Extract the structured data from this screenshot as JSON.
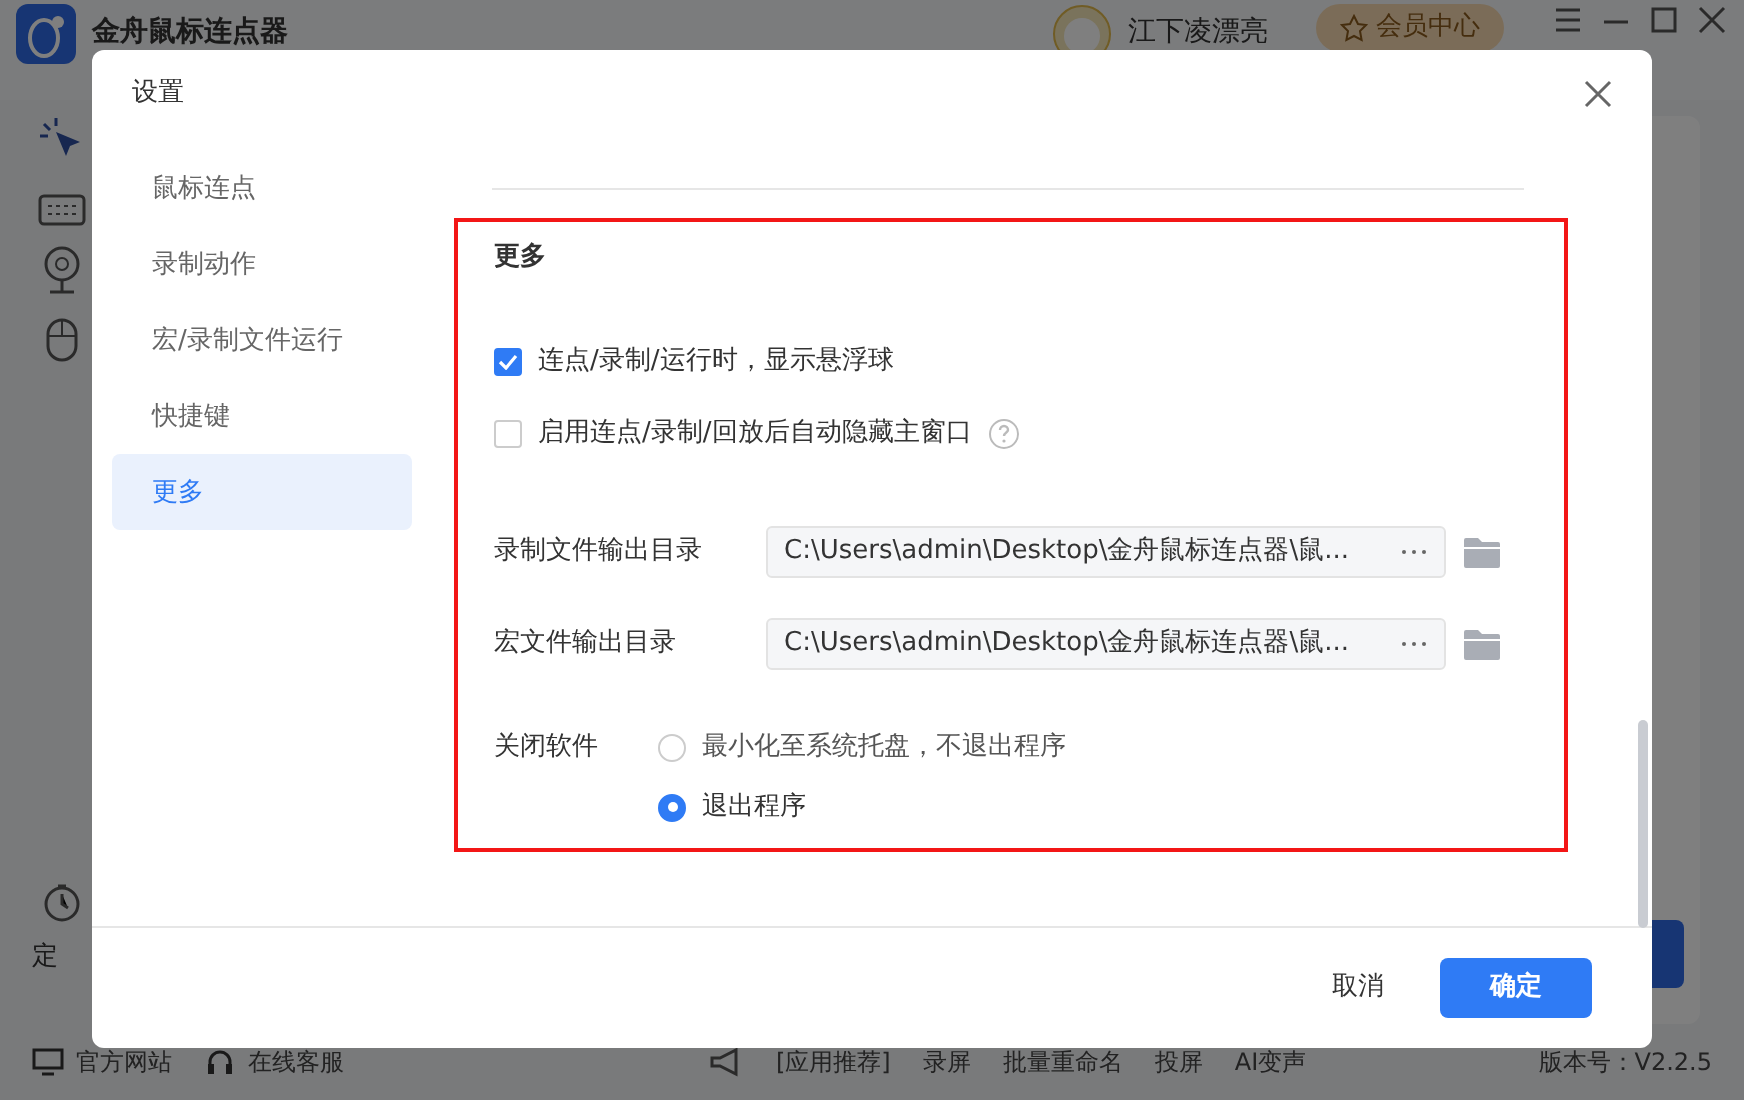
{
  "app": {
    "title": "金舟鼠标连点器",
    "user_name": "江下凌漂亮",
    "vip_button": "会员中心",
    "sidebar_label": "定",
    "footer_links": [
      "官方网站",
      "在线客服"
    ],
    "promo": {
      "label": "[应用推荐]",
      "items": [
        "录屏",
        "批量重命名",
        "投屏",
        "AI变声"
      ]
    },
    "version": "版本号：V2.2.5"
  },
  "dialog": {
    "title": "设置",
    "nav": [
      {
        "label": "鼠标连点",
        "selected": false
      },
      {
        "label": "录制动作",
        "selected": false
      },
      {
        "label": "宏/录制文件运行",
        "selected": false
      },
      {
        "label": "快捷键",
        "selected": false
      },
      {
        "label": "更多",
        "selected": true
      }
    ],
    "section_title": "更多",
    "checkboxes": [
      {
        "label": "连点/录制/运行时，显示悬浮球",
        "checked": true,
        "help": false
      },
      {
        "label": "启用连点/录制/回放后自动隐藏主窗口",
        "checked": false,
        "help": true
      }
    ],
    "paths": [
      {
        "label": "录制文件输出目录",
        "value": "C:\\Users\\admin\\Desktop\\金舟鼠标连点器\\鼠..."
      },
      {
        "label": "宏文件输出目录",
        "value": "C:\\Users\\admin\\Desktop\\金舟鼠标连点器\\鼠..."
      }
    ],
    "close_option": {
      "label": "关闭软件",
      "options": [
        {
          "label": "最小化至系统托盘，不退出程序",
          "selected": false
        },
        {
          "label": "退出程序",
          "selected": true
        }
      ]
    },
    "buttons": [
      {
        "label": "取消",
        "kind": "secondary"
      },
      {
        "label": "确定",
        "kind": "primary"
      }
    ]
  }
}
